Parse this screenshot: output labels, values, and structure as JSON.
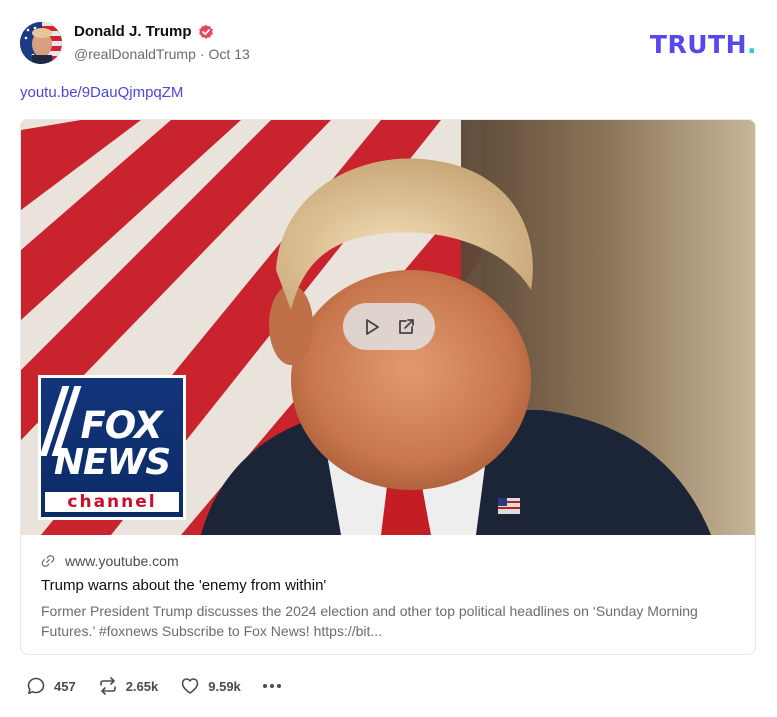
{
  "post": {
    "author": {
      "display_name": "Donald J. Trump",
      "handle": "@realDonaldTrump",
      "separator": "·",
      "date": "Oct 13",
      "verified": true
    },
    "brand_logo": {
      "text": "TRUTH",
      "dot": ".",
      "colors": {
        "text": "#5448ee",
        "dot": "#37c9c9"
      }
    },
    "link_text": "youtu.be/9DauQjmpqZM",
    "link_card": {
      "thumbnail": {
        "overlay_icons": [
          "play-icon",
          "external-link-icon"
        ],
        "logo_text_line1": "FOX",
        "logo_text_line2": "NEWS",
        "logo_text_line3": "channel"
      },
      "domain": "www.youtube.com",
      "title": "Trump warns about the 'enemy from within'",
      "description": "Former President Trump discusses the 2024 election and other top political headlines on ‘Sunday Morning Futures.’ #foxnews Subscribe to Fox News! https://bit..."
    },
    "actions": {
      "replies": {
        "icon": "comment-icon",
        "count": "457"
      },
      "reposts": {
        "icon": "repost-icon",
        "count": "2.65k"
      },
      "likes": {
        "icon": "heart-icon",
        "count": "9.59k"
      },
      "more": {
        "icon": "more-dots-icon"
      }
    },
    "colors": {
      "accent": "#4b47d9",
      "verified_badge": "#e5485f",
      "muted": "#6b6b75"
    }
  }
}
